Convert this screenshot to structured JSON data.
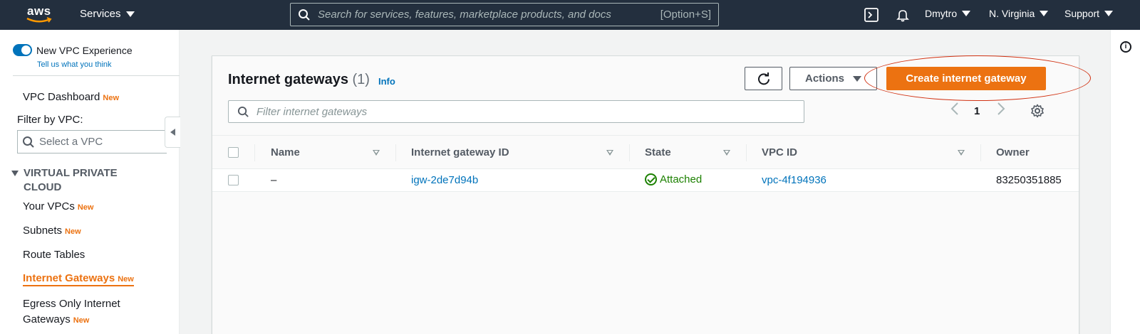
{
  "topnav": {
    "logo_text": "aws",
    "services_label": "Services",
    "search_placeholder": "Search for services, features, marketplace products, and docs",
    "search_shortcut": "[Option+S]",
    "user_label": "Dmytro",
    "region_label": "N. Virginia",
    "support_label": "Support",
    "bg_color": "#232f3e"
  },
  "sidebar": {
    "toggle_label": "New VPC Experience",
    "feedback_link": "Tell us what you think",
    "dashboard_label": "VPC Dashboard",
    "new_badge": "New",
    "filter_label": "Filter by VPC:",
    "select_placeholder": "Select a VPC",
    "section_title": "VIRTUAL PRIVATE CLOUD",
    "items": [
      {
        "label": "Your VPCs",
        "badge": "New"
      },
      {
        "label": "Subnets",
        "badge": "New"
      },
      {
        "label": "Route Tables",
        "badge": ""
      },
      {
        "label": "Internet Gateways",
        "badge": "New",
        "active": true
      },
      {
        "label": "Egress Only Internet",
        "label_line2": "Gateways",
        "badge": "New"
      }
    ]
  },
  "main": {
    "title": "Internet gateways",
    "count": "(1)",
    "info_link": "Info",
    "actions_label": "Actions",
    "create_label": "Create internet gateway",
    "filter_placeholder": "Filter internet gateways",
    "page_number": "1",
    "columns": [
      "Name",
      "Internet gateway ID",
      "State",
      "VPC ID",
      "Owner"
    ],
    "rows": [
      {
        "name": "–",
        "gateway_id": "igw-2de7d94b",
        "state": "Attached",
        "vpc_id": "vpc-4f194936",
        "owner": "83250351885"
      }
    ],
    "accent_color": "#ec7211",
    "link_color": "#0073bb",
    "success_color": "#1d8102"
  }
}
